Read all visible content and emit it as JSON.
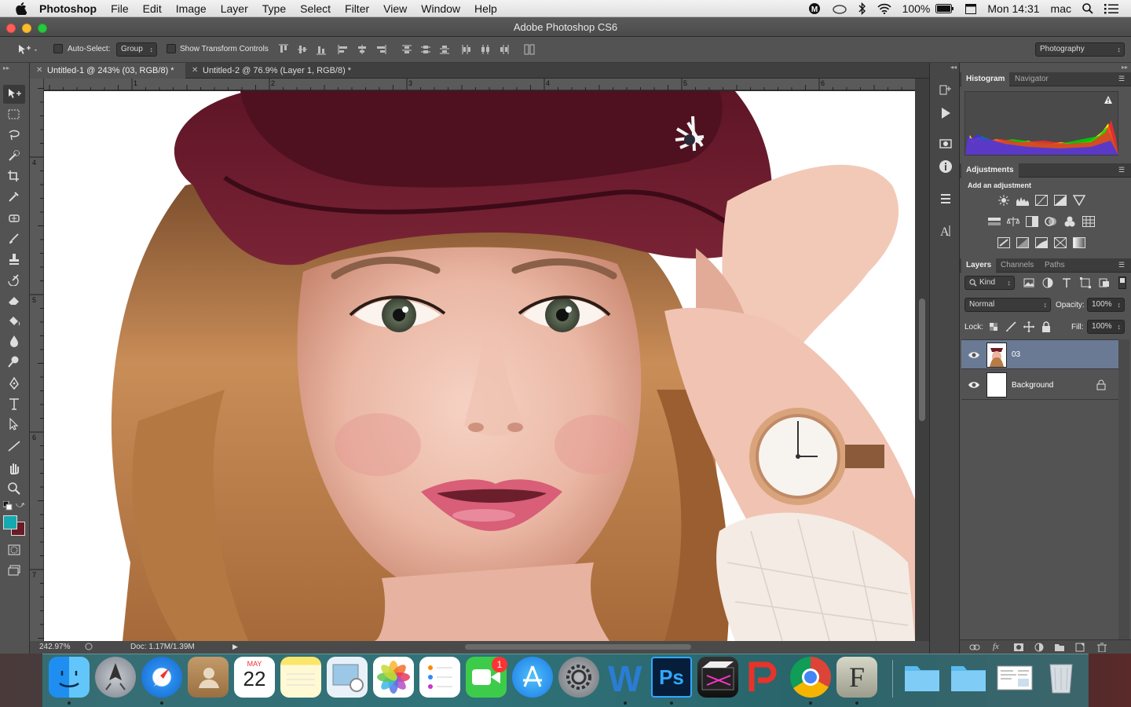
{
  "menubar": {
    "app": "Photoshop",
    "items": [
      "File",
      "Edit",
      "Image",
      "Layer",
      "Type",
      "Select",
      "Filter",
      "View",
      "Window",
      "Help"
    ],
    "battery": "100%",
    "clock": "Mon 14:31",
    "user": "mac"
  },
  "window": {
    "title": "Adobe Photoshop CS6"
  },
  "options": {
    "auto_select_label": "Auto-Select:",
    "auto_select_value": "Group",
    "transform_label": "Show Transform Controls",
    "workspace": "Photography"
  },
  "tabs": [
    {
      "label": "Untitled-1 @ 243% (03, RGB/8) *",
      "active": true
    },
    {
      "label": "Untitled-2 @ 76.9% (Layer 1, RGB/8) *",
      "active": false
    }
  ],
  "ruler": {
    "h": [
      "1",
      "2",
      "3",
      "4",
      "5",
      "6"
    ],
    "v": [
      "4",
      "5",
      "6",
      "7"
    ]
  },
  "status": {
    "zoom": "242.97%",
    "doc": "Doc: 1.17M/1.39M"
  },
  "panels": {
    "histogram_tabs": [
      "Histogram",
      "Navigator"
    ],
    "adjustments_tab": "Adjustments",
    "adjustments_heading": "Add an adjustment",
    "layers_tabs": [
      "Layers",
      "Channels",
      "Paths"
    ],
    "kind": "Kind",
    "blend_mode": "Normal",
    "opacity_label": "Opacity:",
    "opacity": "100%",
    "lock_label": "Lock:",
    "fill_label": "Fill:",
    "fill": "100%",
    "layers": [
      {
        "name": "03",
        "selected": true
      },
      {
        "name": "Background",
        "selected": false,
        "locked": true
      }
    ]
  },
  "dock": {
    "calendar_month": "MAY",
    "calendar_day": "22",
    "facetime_badge": "1",
    "apps": [
      "Finder",
      "Launchpad",
      "Safari",
      "Contacts",
      "Calendar",
      "Notes",
      "Preview",
      "Photos",
      "Reminders",
      "FaceTime",
      "App Store",
      "System Preferences",
      "Word",
      "Photoshop",
      "Final Cut Pro",
      "WPS",
      "Chrome",
      "FontLab",
      "Folder",
      "Folder",
      "Document",
      "Trash"
    ],
    "ps_label": "Ps",
    "f_label": "F"
  },
  "colors": {
    "foreground": "#17a9b0",
    "background": "#6b1b25",
    "layer_selected": "#6a7a94"
  }
}
